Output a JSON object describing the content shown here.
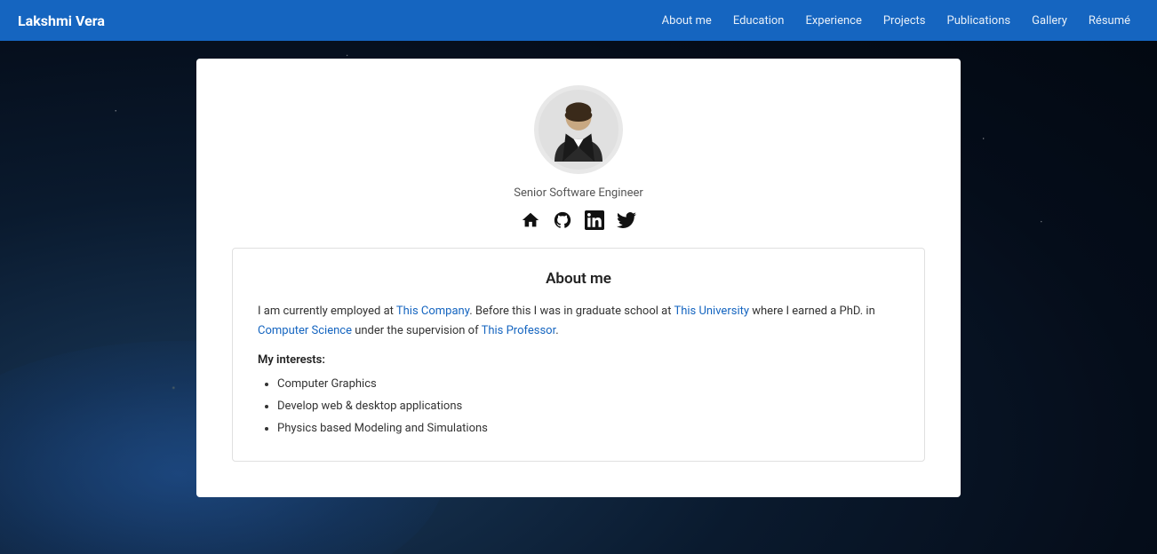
{
  "brand": "Lakshmi Vera",
  "nav": {
    "links": [
      {
        "label": "About me",
        "href": "#about"
      },
      {
        "label": "Education",
        "href": "#education"
      },
      {
        "label": "Experience",
        "href": "#experience"
      },
      {
        "label": "Projects",
        "href": "#projects"
      },
      {
        "label": "Publications",
        "href": "#publications"
      },
      {
        "label": "Gallery",
        "href": "#gallery"
      },
      {
        "label": "Résumé",
        "href": "#resume"
      }
    ]
  },
  "profile": {
    "title": "Senior Software Engineer"
  },
  "about": {
    "heading": "About me",
    "bio_prefix": "I am currently employed at ",
    "company_link": "This Company",
    "bio_mid1": ". Before this I was in graduate school at ",
    "university_link": "This University",
    "bio_mid2": " where I earned a PhD. in ",
    "field_link": "Computer Science",
    "bio_suffix": " under the supervision of ",
    "professor_link": "This Professor",
    "bio_end": ".",
    "interests_label": "My interests:",
    "interests": [
      "Computer Graphics",
      "Develop web & desktop applications",
      "Physics based Modeling and Simulations"
    ]
  },
  "social": [
    {
      "name": "home-icon",
      "title": "Home"
    },
    {
      "name": "github-icon",
      "title": "GitHub"
    },
    {
      "name": "linkedin-icon",
      "title": "LinkedIn"
    },
    {
      "name": "twitter-icon",
      "title": "Twitter"
    }
  ]
}
